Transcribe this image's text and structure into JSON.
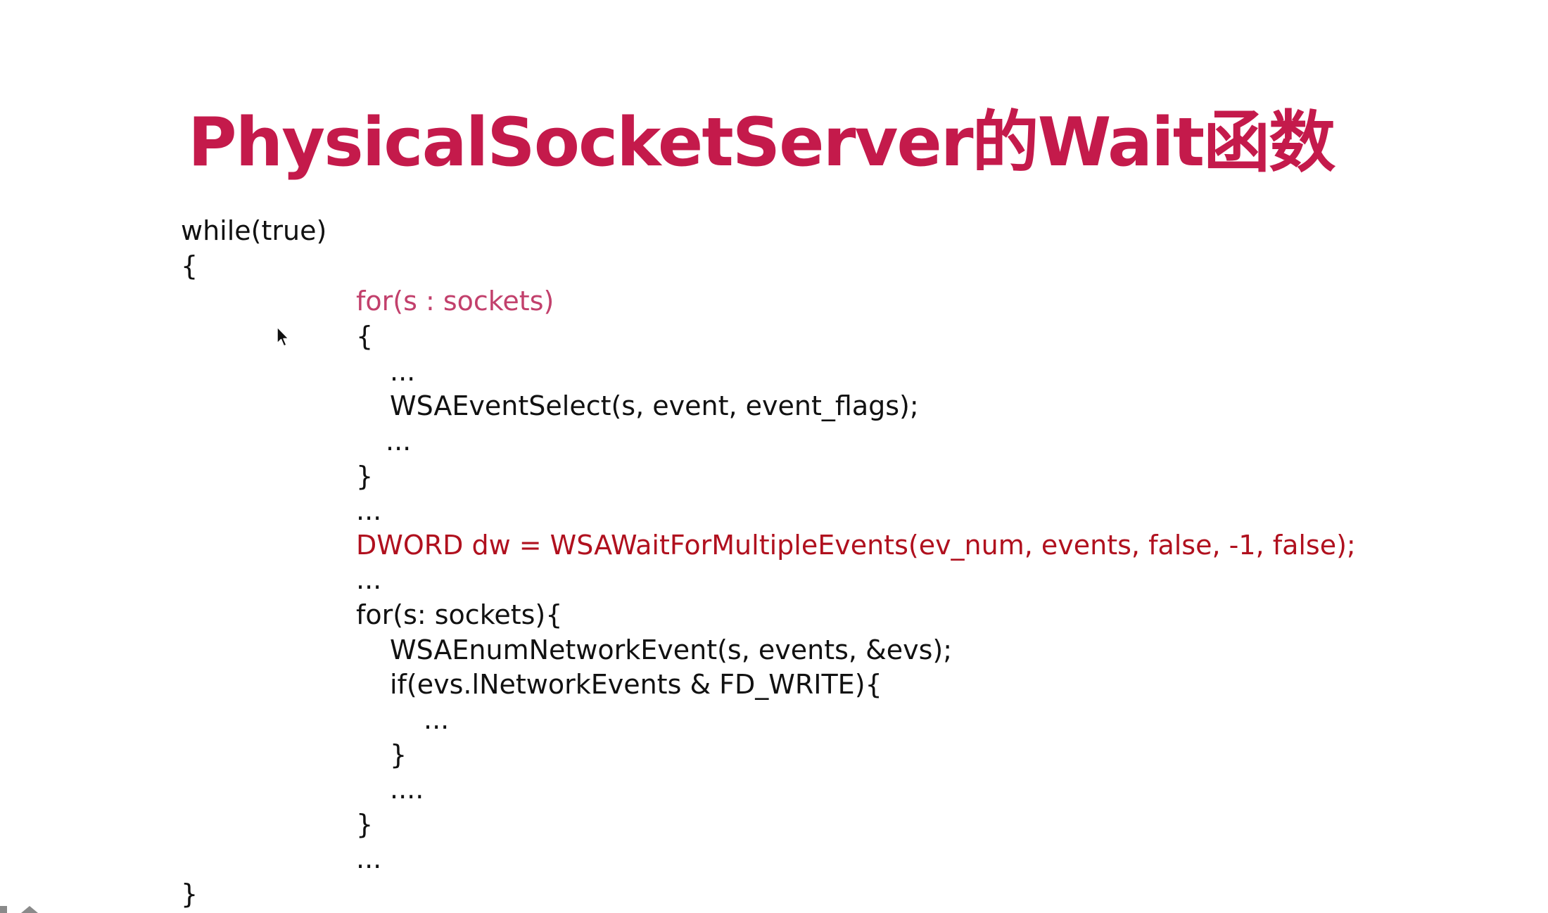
{
  "slide": {
    "title": "PhysicalSocketServer的Wait函数",
    "title_color": "#c41a4b",
    "code_lines": [
      {
        "text": "while(true)",
        "color": "#111111"
      },
      {
        "text": "{",
        "color": "#111111"
      },
      {
        "text": "for(s : sockets)",
        "color": "#c2406c"
      },
      {
        "text": "{",
        "color": "#111111"
      },
      {
        "text": "...",
        "color": "#111111"
      },
      {
        "text": "WSAEventSelect(s, event, event_flags);",
        "color": "#111111"
      },
      {
        "text": "...",
        "color": "#111111"
      },
      {
        "text": "}",
        "color": "#111111"
      },
      {
        "text": "...",
        "color": "#111111"
      },
      {
        "text": "DWORD dw = WSAWaitForMultipleEvents(ev_num, events, false, -1, false);",
        "color": "#b0101e"
      },
      {
        "text": "...",
        "color": "#111111"
      },
      {
        "text": "for(s: sockets){",
        "color": "#111111"
      },
      {
        "text": "WSAEnumNetworkEvent(s, events, &evs);",
        "color": "#111111"
      },
      {
        "text": "if(evs.lNetworkEvents & FD_WRITE){",
        "color": "#111111"
      },
      {
        "text": "...",
        "color": "#111111"
      },
      {
        "text": "}",
        "color": "#111111"
      },
      {
        "text": "....",
        "color": "#111111"
      },
      {
        "text": "}",
        "color": "#111111"
      },
      {
        "text": "...",
        "color": "#111111"
      },
      {
        "text": "}",
        "color": "#111111"
      }
    ]
  },
  "icons": {
    "cursor": "mouse-pointer-icon"
  }
}
